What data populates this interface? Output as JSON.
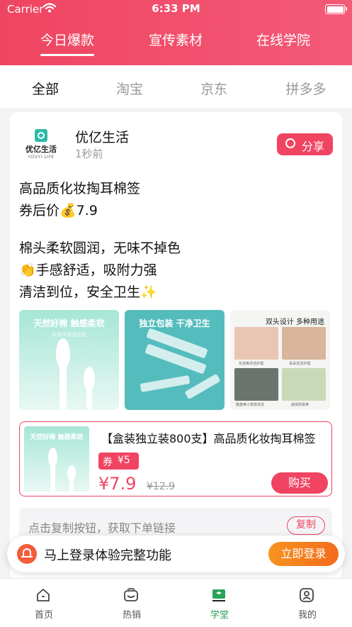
{
  "status_bar": {
    "carrier": "Carrier",
    "time": "6:33 PM"
  },
  "top_tabs": [
    {
      "label": "今日爆款",
      "active": true
    },
    {
      "label": "宣传素材",
      "active": false
    },
    {
      "label": "在线学院",
      "active": false
    }
  ],
  "sub_tabs": [
    {
      "label": "全部",
      "active": true
    },
    {
      "label": "淘宝",
      "active": false
    },
    {
      "label": "京东",
      "active": false
    },
    {
      "label": "拼多多",
      "active": false
    }
  ],
  "post": {
    "author": "优亿生活",
    "logo_text": "优亿生活",
    "logo_subtext": "YOUYI LIFE",
    "posted_time": "1秒前",
    "share_label": "分享",
    "lines": [
      "高品质化妆掏耳棉签",
      "券后价💰7.9",
      "棉头柔软圆润，无味不掉色",
      "👏手感舒适，吸附力强",
      "清洁到位，安全卫生✨"
    ],
    "images": [
      {
        "caption": "天然好棉 触感柔软",
        "subcaption": "采用环保食品级"
      },
      {
        "caption": "独立包装 干净卫生"
      },
      {
        "caption": "双头设计 多种用途",
        "photo_captions": [
          "化妆等清洁护理",
          "耳朵清洁护理",
          "键盘等小角落清洁",
          "搓揉药膏等"
        ]
      }
    ],
    "product": {
      "title": "【盒装独立装800支】高品质化妆掏耳棉签",
      "thumb_caption": "天然好棉 触感柔软",
      "coupon_label": "券",
      "coupon_amount": "¥5",
      "price": "¥7.9",
      "original_price": "¥12.9",
      "buy_label": "购买"
    },
    "copy_hint": "点击复制按钮，获取下单链接",
    "copy_label": "复制"
  },
  "login_banner": {
    "text": "马上登录体验完整功能",
    "button": "立即登录"
  },
  "tabbar": [
    {
      "label": "首页",
      "icon": "home-icon",
      "active": false
    },
    {
      "label": "热销",
      "icon": "hot-sale-icon",
      "active": false
    },
    {
      "label": "学堂",
      "icon": "school-icon",
      "active": true
    },
    {
      "label": "我的",
      "icon": "profile-icon",
      "active": false
    }
  ],
  "colors": {
    "brand": "#f04462",
    "accent_orange": "#f7931e",
    "active_tab": "#2aa25a"
  }
}
